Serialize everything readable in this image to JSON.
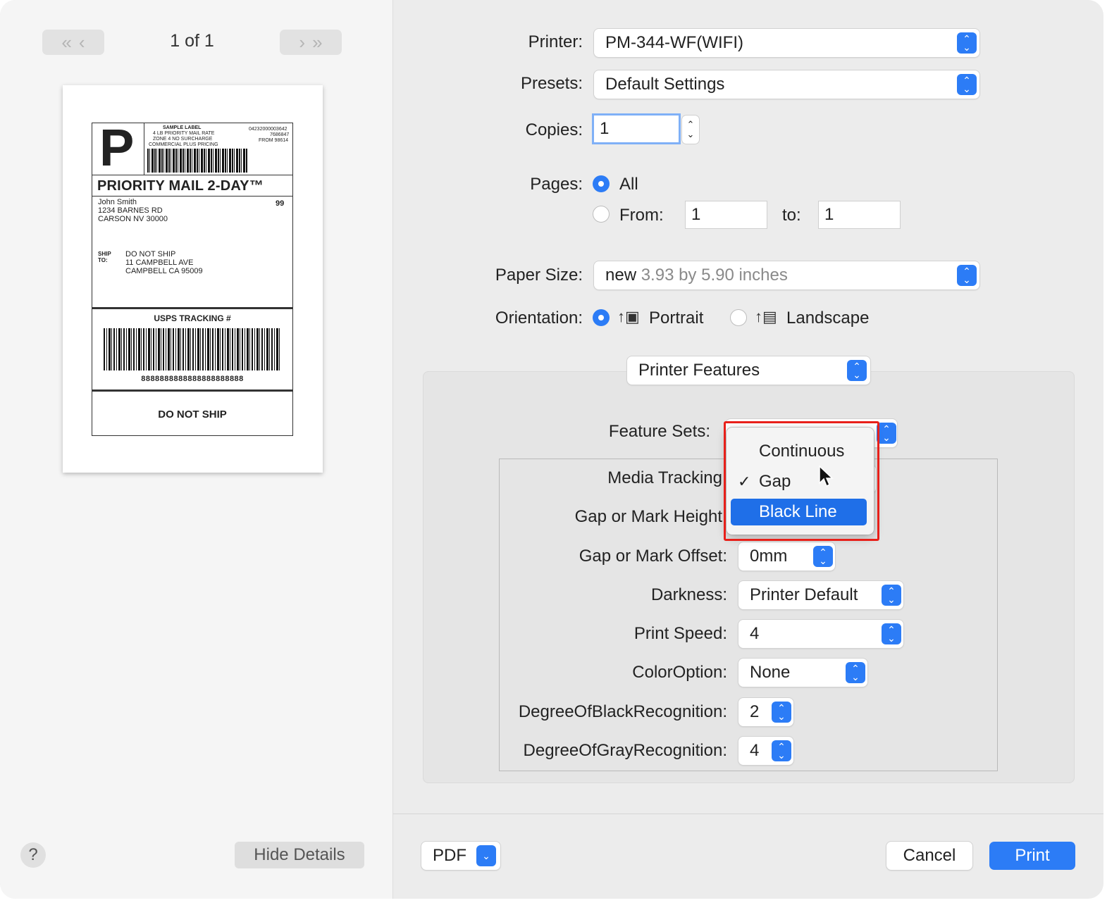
{
  "preview": {
    "page_counter": "1 of 1",
    "nav_first": "«",
    "nav_prev": "‹",
    "nav_next": "›",
    "nav_last": "»",
    "label": {
      "service_letter": "P",
      "sample_label": "SAMPLE LABEL",
      "rate_lines": [
        "4 LB PRIORITY MAIL RATE",
        "ZONE 4 NO SURCHARGE",
        "COMMERCIAL PLUS PRICING"
      ],
      "right_lines": [
        "04232000003642",
        "7686847",
        "FROM 98614"
      ],
      "service_name": "PRIORITY MAIL 2-DAY™",
      "from_lines": [
        "John Smith",
        "1234 BARNES RD",
        "CARSON NV 30000"
      ],
      "zone_code": "99",
      "ship_to_label": "SHIP TO:",
      "to_lines": [
        "DO NOT SHIP",
        "11 CAMPBELL AVE",
        "CAMPBELL CA 95009"
      ],
      "tracking_title": "USPS TRACKING #",
      "tracking_number": "8888888888888888888888",
      "footer": "DO NOT SHIP"
    },
    "help_label": "?",
    "hide_details_label": "Hide Details"
  },
  "settings": {
    "printer": {
      "label": "Printer:",
      "value": "PM-344-WF(WIFI)"
    },
    "presets": {
      "label": "Presets:",
      "value": "Default Settings"
    },
    "copies": {
      "label": "Copies:",
      "value": "1"
    },
    "pages": {
      "label": "Pages:",
      "all_label": "All",
      "from_label": "From:",
      "from_value": "1",
      "to_label": "to:",
      "to_value": "1",
      "selected": "All"
    },
    "paper_size": {
      "label": "Paper Size:",
      "name": "new",
      "dims": "3.93 by 5.90 inches"
    },
    "orientation": {
      "label": "Orientation:",
      "portrait_label": "Portrait",
      "landscape_label": "Landscape",
      "selected": "Portrait"
    },
    "section_popup": "Printer Features"
  },
  "features": {
    "feature_sets_label": "Feature Sets:",
    "rows": [
      {
        "label": "Media Tracking",
        "value": ""
      },
      {
        "label": "Gap or Mark Height",
        "value": ""
      },
      {
        "label": "Gap or Mark Offset:",
        "value": "0mm"
      },
      {
        "label": "Darkness:",
        "value": "Printer Default"
      },
      {
        "label": "Print Speed:",
        "value": "4"
      },
      {
        "label": "ColorOption:",
        "value": "None"
      },
      {
        "label": "DegreeOfBlackRecognition:",
        "value": "2"
      },
      {
        "label": "DegreeOfGrayRecognition:",
        "value": "4"
      }
    ]
  },
  "dropdown": {
    "items": [
      {
        "label": "Continuous",
        "checked": false,
        "highlighted": false
      },
      {
        "label": "Gap",
        "checked": true,
        "highlighted": false
      },
      {
        "label": "Black Line",
        "checked": false,
        "highlighted": true
      }
    ],
    "check_glyph": "✓"
  },
  "footer": {
    "pdf_label": "PDF",
    "cancel_label": "Cancel",
    "print_label": "Print"
  },
  "colors": {
    "accent": "#2c7cf6",
    "menu_highlight": "#1f6fe8",
    "highlight_box": "#e8201a",
    "window_bg": "#ececec"
  }
}
